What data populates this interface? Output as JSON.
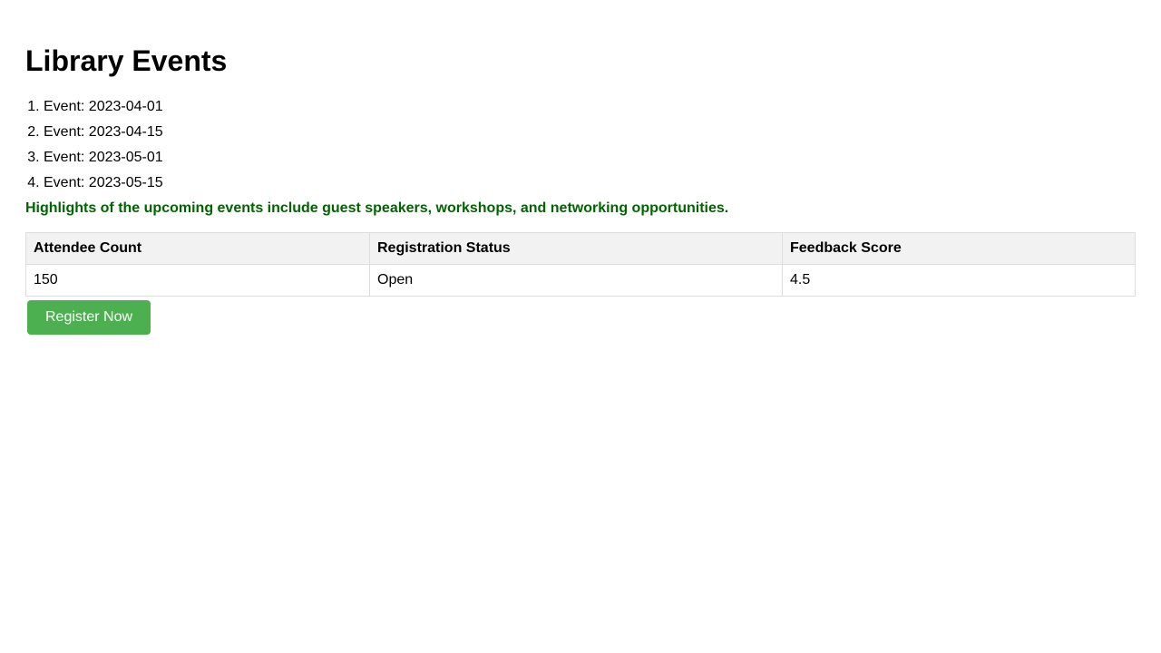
{
  "page": {
    "title": "Library Events"
  },
  "events": {
    "items": [
      {
        "label": "Event: 2023-04-01"
      },
      {
        "label": "Event: 2023-04-15"
      },
      {
        "label": "Event: 2023-05-01"
      },
      {
        "label": "Event: 2023-05-15"
      }
    ]
  },
  "highlights": {
    "text": "Highlights of the upcoming events include guest speakers, workshops, and networking opportunities.",
    "color": "#006400"
  },
  "table": {
    "headers": [
      "Attendee Count",
      "Registration Status",
      "Feedback Score"
    ],
    "rows": [
      [
        "150",
        "Open",
        "4.5"
      ]
    ]
  },
  "register_button": {
    "label": "Register Now",
    "color": "#4caf50"
  }
}
